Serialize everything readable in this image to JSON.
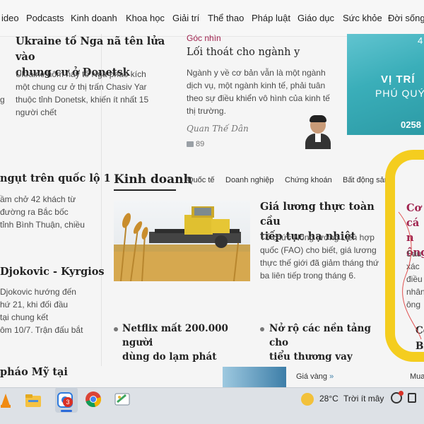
{
  "nav": {
    "items": [
      "ideo",
      "Podcasts",
      "Kinh doanh",
      "Khoa học",
      "Giải trí",
      "Thể thao",
      "Pháp luật",
      "Giáo dục",
      "Sức khỏe",
      "Đời sống"
    ]
  },
  "top_article": {
    "title_line1": "Ukraine tố Nga nã tên lửa vào",
    "title_line2": "chung cư ở Donetsk",
    "excerpt_line1": "Ukraine hôm nay tố Nga pháo kích",
    "excerpt_line2": "một chung cư ở thị trấn Chasiv Yar",
    "excerpt_line3": "thuộc tỉnh Donetsk, khiến ít nhất 15",
    "excerpt_line4": "người chết",
    "edge_char": "g"
  },
  "opinion": {
    "label": "Góc nhìn",
    "title": "Lối thoát cho ngành y",
    "excerpt_line1": "Ngành y về cơ bản vẫn là một ngành",
    "excerpt_line2": "dịch vụ, một ngành kinh tế, phải tuân",
    "excerpt_line3": "theo sự điều khiển vô hình của kinh tế",
    "excerpt_line4": "thị trường.",
    "author": "Quan Thế Dân",
    "comments": "89"
  },
  "ad": {
    "top_char": "4",
    "line1": "VỊ TRÍ",
    "line2": "PHÚ QUÝ",
    "line3": "0258"
  },
  "left_col": {
    "story1_title": "ngụt trên quốc lộ 1",
    "story1_line1": "ầm chở 42 khách từ",
    "story1_line2": "đường ra Bắc bốc",
    "story1_line3": "tỉnh Bình Thuận, chiều",
    "story2_title": "Djokovic - Kyrgios",
    "story2_line1": "Djokovic hướng đến",
    "story2_line2": "hứ 21, khi đối đầu",
    "story2_line3": "tại chung kết",
    "story2_line4": "ôm 10/7. Trận đấu bắt",
    "story3_title": "pháo Mỹ tại"
  },
  "business": {
    "heading": "Kinh doanh",
    "subtabs": [
      "Quốc tế",
      "Doanh nghiệp",
      "Chứng khoán",
      "Bất động sản"
    ],
    "lead_title_line1": "Giá lương thực toàn cầu",
    "lead_title_line2": "tiếp tục hạ nhiệt",
    "lead_line1": "Tổ chức Nông lương Liên hợp",
    "lead_line2": "quốc (FAO) cho biết, giá lương",
    "lead_line3": "thực thế giới đã giảm tháng thứ",
    "lead_line4": "ba liên tiếp trong tháng 6.",
    "item1_line1": "Netflix mất 200.000 người",
    "item1_line2": "dùng do lạm phát",
    "item2_line1": "Nở rộ các nền tảng cho",
    "item2_line2": "tiểu thương vay",
    "gold_label": "Giá vàng",
    "gold_arrow": "»",
    "right_edge": "Mua"
  },
  "right_col": {
    "title_line1": "Cơ",
    "title_line2": "cá n",
    "title_line3": "ông",
    "body_line1": "Sau",
    "body_line2": "xác",
    "body_line3": "điều",
    "body_line4": "nhân",
    "body_line5": "ông",
    "item_line1": "Co",
    "item_line2": "Bri"
  },
  "taskbar": {
    "badge": "3",
    "temperature": "28°C",
    "weather": "Trời ít mây"
  },
  "colors": {
    "accent_label": "#9f224e",
    "highlight": "#f4cd1f",
    "ad_bg": "#3aaeb9"
  }
}
